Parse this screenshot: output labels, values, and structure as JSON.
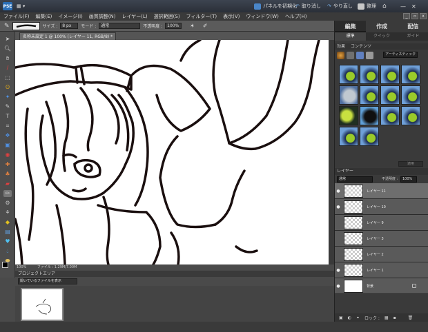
{
  "titlebar": {
    "logo_text": "PSE",
    "mode_label": "▦ ▾",
    "panel_init_label": "パネルを初期化",
    "undo_label": "取り消し",
    "redo_label": "やり直し",
    "organizer_label": "整理"
  },
  "menu": [
    "ファイル(F)",
    "編集(E)",
    "イメージ(I)",
    "画質調整(N)",
    "レイヤー(L)",
    "選択範囲(S)",
    "フィルター(T)",
    "表示(V)",
    "ウィンドウ(W)",
    "ヘルプ(H)"
  ],
  "options": {
    "size_label": "サイズ :",
    "size_value": "8 px",
    "mode_label": "モード :",
    "mode_value": "通常",
    "opacity_label": "不透明度 :",
    "opacity_value": "100%"
  },
  "document": {
    "tab_label": "名称未設定 1 @ 100% (レイヤー 11, RGB/8) *",
    "status_zoom": "100%",
    "status_info": "ファイル : 1.29M/7.00M"
  },
  "project_bin": {
    "header": "プロジェクトエリア",
    "dropdown": "開いているファイルを表示"
  },
  "right_panel": {
    "tabs": [
      "編集",
      "作成",
      "配信"
    ],
    "subtabs": [
      "標準",
      "クイック",
      "ガイド"
    ],
    "effects": {
      "header": "効果",
      "sub_header": "コンテンツ",
      "filter_dropdown": "アーティスティック",
      "apply_label": "適用",
      "thumb_count": 14
    },
    "layers": {
      "header": "レイヤー",
      "blend_mode": "通常",
      "opacity_label": "不透明度 :",
      "opacity_value": "100%",
      "items": [
        {
          "name": "レイヤー 11",
          "selected": true,
          "visible": true
        },
        {
          "name": "レイヤー 10",
          "selected": false,
          "visible": true
        },
        {
          "name": "レイヤー 9",
          "selected": false,
          "visible": false
        },
        {
          "name": "レイヤー 3",
          "selected": false,
          "visible": false
        },
        {
          "name": "レイヤー 2",
          "selected": false,
          "visible": false
        },
        {
          "name": "レイヤー 1",
          "selected": false,
          "visible": true
        },
        {
          "name": "背景",
          "selected": false,
          "visible": true,
          "locked": true
        }
      ],
      "footer_lock_label": "ロック :"
    }
  },
  "colors": {
    "accent": "#2b6fb8",
    "line_art": "#1a0f0f",
    "canvas": "#ffffff"
  }
}
